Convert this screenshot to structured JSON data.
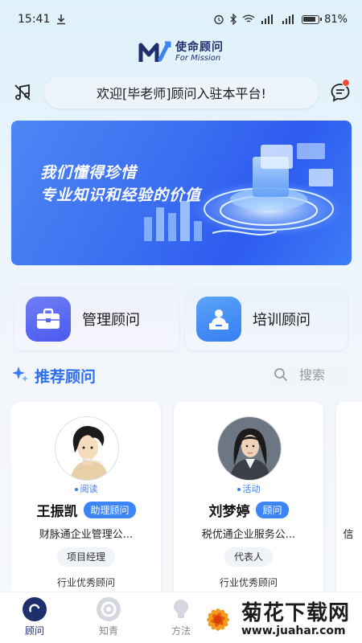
{
  "status_bar": {
    "time": "15:41",
    "battery": "81%"
  },
  "logo": {
    "cn": "使命顾问",
    "en": "For Mission"
  },
  "notice": {
    "text": "欢迎[毕老师]顾问入驻本平台!"
  },
  "banner": {
    "line1": "我们懂得珍惜",
    "line2": "专业知识和经验的价值"
  },
  "categories": [
    {
      "label": "管理顾问",
      "icon": "briefcase-icon"
    },
    {
      "label": "培训顾问",
      "icon": "trainer-icon"
    }
  ],
  "section": {
    "title": "推荐顾问",
    "search_placeholder": "搜索"
  },
  "advisors": [
    {
      "status": "阅读",
      "name": "王振凯",
      "role": "助理顾问",
      "company": "财脉通企业管理公...",
      "position": "项目经理",
      "honor": "行业优秀顾问"
    },
    {
      "status": "活动",
      "name": "刘梦婷",
      "role": "顾问",
      "company": "税优通企业服务公...",
      "position": "代表人",
      "honor": "行业优秀顾问"
    },
    {
      "company": "信"
    }
  ],
  "bottom_nav": [
    {
      "label": "顾问",
      "icon": "advisor-c-icon",
      "active": true
    },
    {
      "label": "知青",
      "icon": "knowledge-icon",
      "active": false
    },
    {
      "label": "方法",
      "icon": "method-icon",
      "active": false
    }
  ],
  "watermark": {
    "cn": "菊花下载网",
    "url": "www.juahar.com"
  },
  "colors": {
    "accent": "#2d6ff0",
    "badge": "#3d84f5",
    "notification": "#f0493d"
  }
}
